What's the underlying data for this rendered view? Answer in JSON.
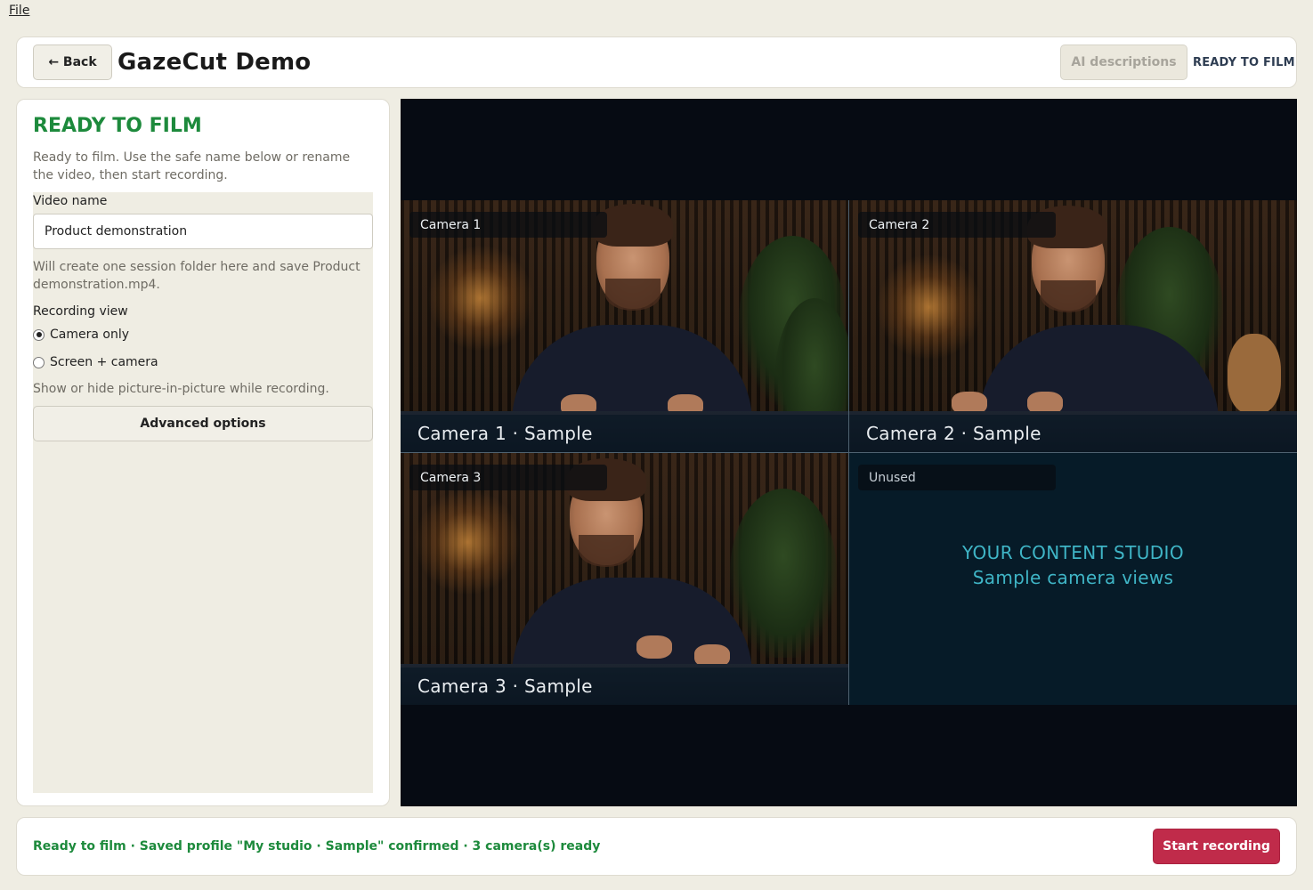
{
  "menu": {
    "file_label": "File"
  },
  "header": {
    "back_label": "← Back",
    "title": "GazeCut Demo",
    "ai_button_label": "AI descriptions",
    "status": "READY TO FILM"
  },
  "panel": {
    "heading": "READY TO FILM",
    "intro": "Ready to film. Use the safe name below or rename the video, then start recording.",
    "video_name_label": "Video name",
    "video_name_value": "Product demonstration",
    "folder_hint": "Will create one session folder here and save Product demonstration.mp4.",
    "recording_view_label": "Recording view",
    "options": [
      {
        "label": "Camera only",
        "selected": true
      },
      {
        "label": "Screen + camera",
        "selected": false
      }
    ],
    "pip_hint": "Show or hide picture-in-picture while recording.",
    "advanced_label": "Advanced options"
  },
  "preview": {
    "tiles": [
      {
        "tag": "Camera 1",
        "caption": "Camera 1 · Sample"
      },
      {
        "tag": "Camera 2",
        "caption": "Camera 2 · Sample"
      },
      {
        "tag": "Camera 3",
        "caption": "Camera 3 · Sample"
      },
      {
        "tag": "Unused",
        "line1": "YOUR CONTENT STUDIO",
        "line2": "Sample camera views"
      }
    ]
  },
  "footer": {
    "status": "Ready to film · Saved profile \"My studio · Sample\" confirmed · 3 camera(s) ready",
    "record_label": "Start recording"
  },
  "colors": {
    "accent_green": "#1d8a3c",
    "record_red": "#c02b4a",
    "studio_teal": "#3fb5c6",
    "preview_bg": "#060b13"
  }
}
